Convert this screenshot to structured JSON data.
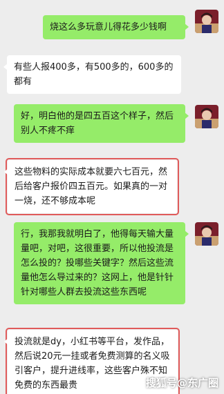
{
  "messages": [
    {
      "id": "m1",
      "side": "out",
      "text": "烧这么多玩意儿得花多少钱啊"
    },
    {
      "id": "m2",
      "side": "in",
      "text": "有些人报400多，有500多的，600多的都有"
    },
    {
      "id": "m3",
      "side": "out",
      "text": "好，明白他的是四五百这个样子，然后别人不疼不痒"
    },
    {
      "id": "m4",
      "side": "in",
      "text": "这些物料的实际成本就要六七百元，然后给客户报价四五百元。如果真的一对一烧，还不够成本呢"
    },
    {
      "id": "m5",
      "side": "out",
      "text": "行，我那我就明白了，他得每天输大量量吧，对吧，这很重要，所以他投流是怎么投的？投哪些关键字？然后这些流量他怎么导过来的？这网上，他是针针针对哪些人群去投流这些东西呢"
    },
    {
      "id": "m6",
      "side": "in",
      "text": "投流就是dy，小红书等平台，发作品，然后说20元一挂或者免费测算的名义吸引客户，提升进线率，这些客户殊不知免费的东西最贵"
    }
  ],
  "watermark": "搜狐号@东广圈",
  "colors": {
    "outgoing": "#95ec69",
    "incoming": "#ffffff",
    "highlight": "#e05a5a",
    "background": "#ededed"
  }
}
